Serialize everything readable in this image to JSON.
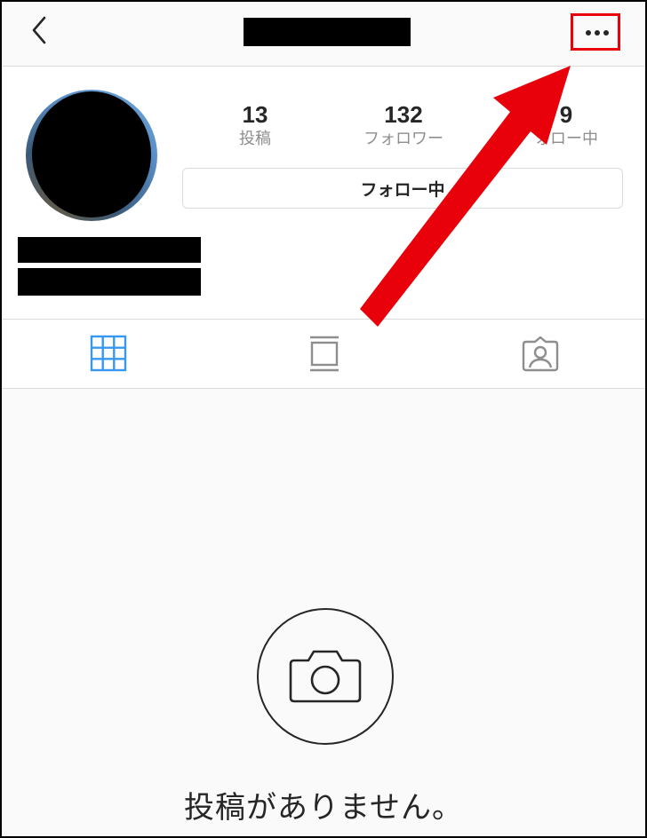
{
  "header": {
    "back_icon": "chevron-left-icon",
    "more_icon": "more-horizontal-icon"
  },
  "profile": {
    "stats": [
      {
        "value": "13",
        "label": "投稿"
      },
      {
        "value": "132",
        "label": "フォロワー"
      },
      {
        "value": "9",
        "label": "ォロー中"
      }
    ],
    "follow_button_label": "フォロー中"
  },
  "tabs": [
    {
      "icon": "grid-icon",
      "active": true
    },
    {
      "icon": "feed-icon",
      "active": false
    },
    {
      "icon": "tagged-person-icon",
      "active": false
    }
  ],
  "empty_state": {
    "icon": "camera-icon",
    "message": "投稿がありません。"
  },
  "colors": {
    "active_tab": "#3897f0",
    "annotation_red": "#e8000b",
    "divider": "#dbdbdb"
  }
}
